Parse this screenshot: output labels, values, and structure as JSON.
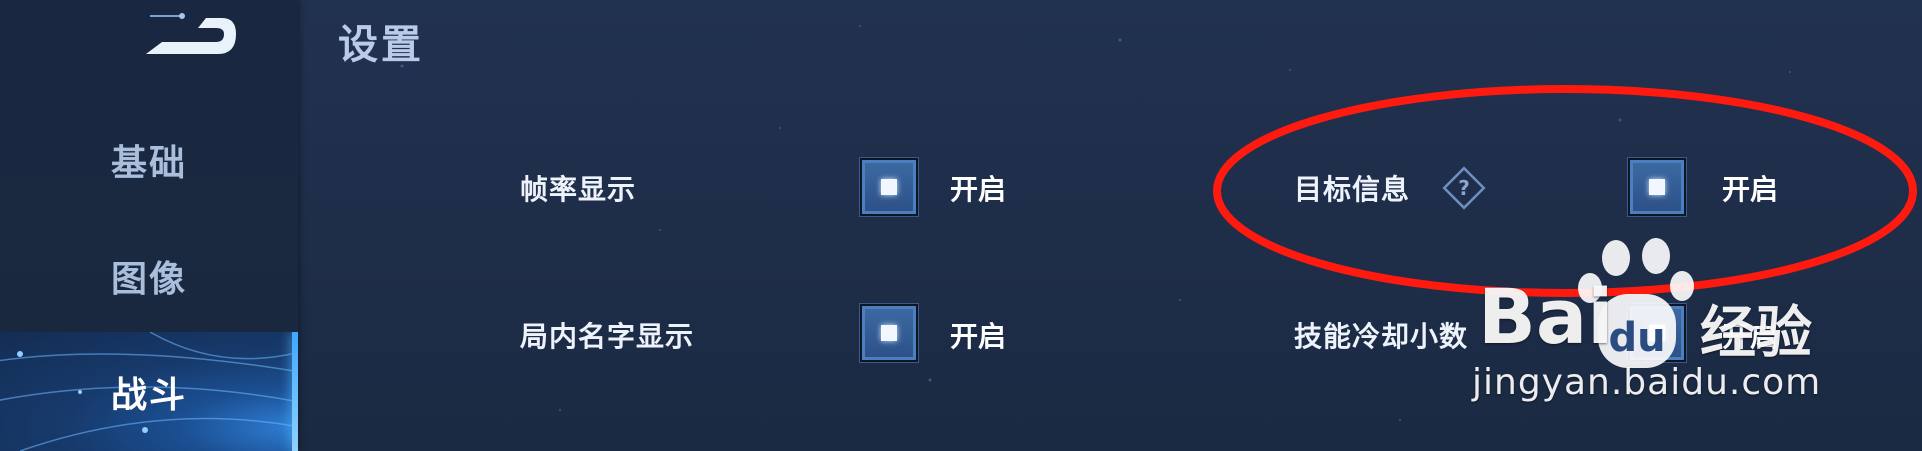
{
  "header": {
    "title": "设置"
  },
  "sidebar": {
    "back_icon": "back-arrow-icon",
    "items": [
      {
        "label": "基础",
        "active": false
      },
      {
        "label": "图像",
        "active": false
      },
      {
        "label": "战斗",
        "active": true
      }
    ]
  },
  "settings": [
    {
      "label": "帧率显示",
      "checked": true,
      "value": "开启"
    },
    {
      "label": "目标信息",
      "checked": true,
      "value": "开启",
      "help_icon": "question-diamond-icon"
    },
    {
      "label": "局内名字显示",
      "checked": true,
      "value": "开启"
    },
    {
      "label": "技能冷却小数",
      "checked": true,
      "value": "开启"
    }
  ],
  "annotation": {
    "shape": "ellipse",
    "color": "#ff1a10"
  },
  "watermark": {
    "brand_left": "Bai",
    "brand_right": "经验",
    "url": "jingyan.baidu.com"
  },
  "colors": {
    "background": "#1e2d48",
    "sidebar": "#1a2740",
    "active_tab": "#1b4f92",
    "accent": "#3fa7ff",
    "checkbox": "#2c5087"
  }
}
